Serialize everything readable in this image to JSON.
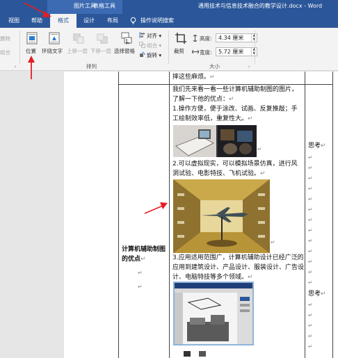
{
  "title_bar": {
    "context_tab_picture": "图片工具",
    "context_tab_table": "表格工具",
    "document_title": "通用技术与信息技术融合的教学设计.docx - Word"
  },
  "tabs": [
    {
      "label": "视图"
    },
    {
      "label": "帮助"
    },
    {
      "label": "格式",
      "active": true
    },
    {
      "label": "设计"
    },
    {
      "label": "布局"
    }
  ],
  "tell_me": "操作说明搜索",
  "ribbon": {
    "left_items": [
      "删除",
      "组合"
    ],
    "position_label": "位置",
    "wrap_text_label": "环绕文字",
    "bring_forward_label": "上移一层",
    "send_backward_label": "下移一层",
    "selection_pane_label": "选择窗格",
    "align_label": "对齐",
    "group_label": "组合",
    "rotate_label": "旋转",
    "arrange_group": "排列",
    "crop_label": "裁剪",
    "height_label": "高度:",
    "height_value": "4.34 厘米",
    "width_label": "宽度:",
    "width_value": "5.72 厘米",
    "size_group": "大小"
  },
  "document": {
    "top_line": "摔这些麻烦。",
    "intro": "我们先来看一看一些计算机辅助制图的图片，了解一下他的优点：",
    "point1": "1.操作方便，便于涂改、试画、反复推敲；手工绘制效率低，重复性大。",
    "point2": "2.可以虚拟现实，可以模拟场景仿真，进行风洞试验、电影特技、飞机试验。",
    "point3": "3.应用适用范围广，计算机辅助设计已经广泛的应用到建筑设计、产品设计、服装设计、广告设计、电脑特技等多个领域。",
    "left_heading": "计算机辅助制图的优点",
    "think1": "思考",
    "think2": "思考",
    "return_mark": "↵"
  },
  "colors": {
    "ribbon_blue": "#2b579a",
    "annotation_red": "#e51c23"
  },
  "icons": [
    "lightbulb-icon",
    "position-icon",
    "wrap-text-icon",
    "bring-forward-icon",
    "send-backward-icon",
    "selection-pane-icon",
    "align-icon",
    "group-icon",
    "rotate-icon",
    "crop-icon",
    "height-icon",
    "width-icon"
  ]
}
